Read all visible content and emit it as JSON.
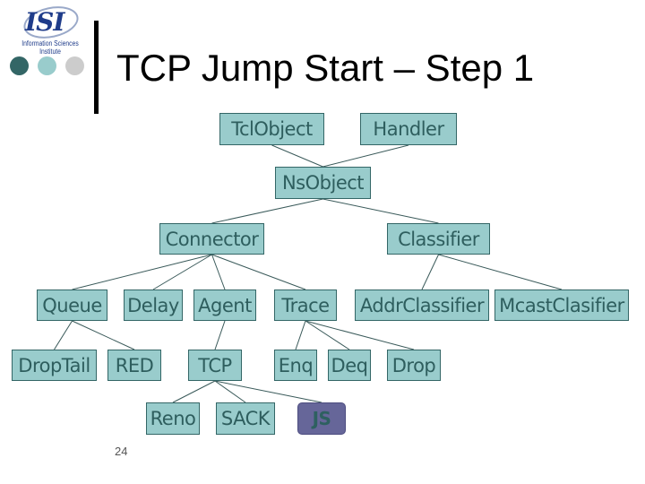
{
  "slide": {
    "title": "TCP Jump Start – Step 1",
    "page_number": "24",
    "logo": {
      "text": "ISI",
      "subtitle": "Information Sciences Institute"
    },
    "bullet_dot_colors": [
      "#336666",
      "#99cccc",
      "#cccccc"
    ]
  },
  "colors": {
    "node_fill": "#99cccc",
    "node_border": "#336666",
    "node_text": "#2e5e5e",
    "highlight_fill": "#666699",
    "edge": "#3a5a5a"
  },
  "diagram": {
    "nodes": [
      {
        "id": "tclobject",
        "label": "TclObject"
      },
      {
        "id": "handler",
        "label": "Handler"
      },
      {
        "id": "nsobject",
        "label": "NsObject"
      },
      {
        "id": "connector",
        "label": "Connector"
      },
      {
        "id": "classifier",
        "label": "Classifier"
      },
      {
        "id": "queue",
        "label": "Queue"
      },
      {
        "id": "delay",
        "label": "Delay"
      },
      {
        "id": "agent",
        "label": "Agent"
      },
      {
        "id": "trace",
        "label": "Trace"
      },
      {
        "id": "addrclassifier",
        "label": "AddrClassifier"
      },
      {
        "id": "mcastclasifier",
        "label": "McastClasifier"
      },
      {
        "id": "droptail",
        "label": "DropTail"
      },
      {
        "id": "red",
        "label": "RED"
      },
      {
        "id": "tcp",
        "label": "TCP"
      },
      {
        "id": "enq",
        "label": "Enq"
      },
      {
        "id": "deq",
        "label": "Deq"
      },
      {
        "id": "drop",
        "label": "Drop"
      },
      {
        "id": "reno",
        "label": "Reno"
      },
      {
        "id": "sack",
        "label": "SACK"
      },
      {
        "id": "js",
        "label": "JS",
        "highlighted": true
      }
    ],
    "edges": [
      [
        "tclobject",
        "nsobject"
      ],
      [
        "handler",
        "nsobject"
      ],
      [
        "nsobject",
        "connector"
      ],
      [
        "nsobject",
        "classifier"
      ],
      [
        "connector",
        "queue"
      ],
      [
        "connector",
        "delay"
      ],
      [
        "connector",
        "agent"
      ],
      [
        "connector",
        "trace"
      ],
      [
        "classifier",
        "addrclassifier"
      ],
      [
        "classifier",
        "mcastclasifier"
      ],
      [
        "queue",
        "droptail"
      ],
      [
        "queue",
        "red"
      ],
      [
        "agent",
        "tcp"
      ],
      [
        "trace",
        "enq"
      ],
      [
        "trace",
        "deq"
      ],
      [
        "trace",
        "drop"
      ],
      [
        "tcp",
        "reno"
      ],
      [
        "tcp",
        "sack"
      ],
      [
        "tcp",
        "js"
      ]
    ]
  }
}
